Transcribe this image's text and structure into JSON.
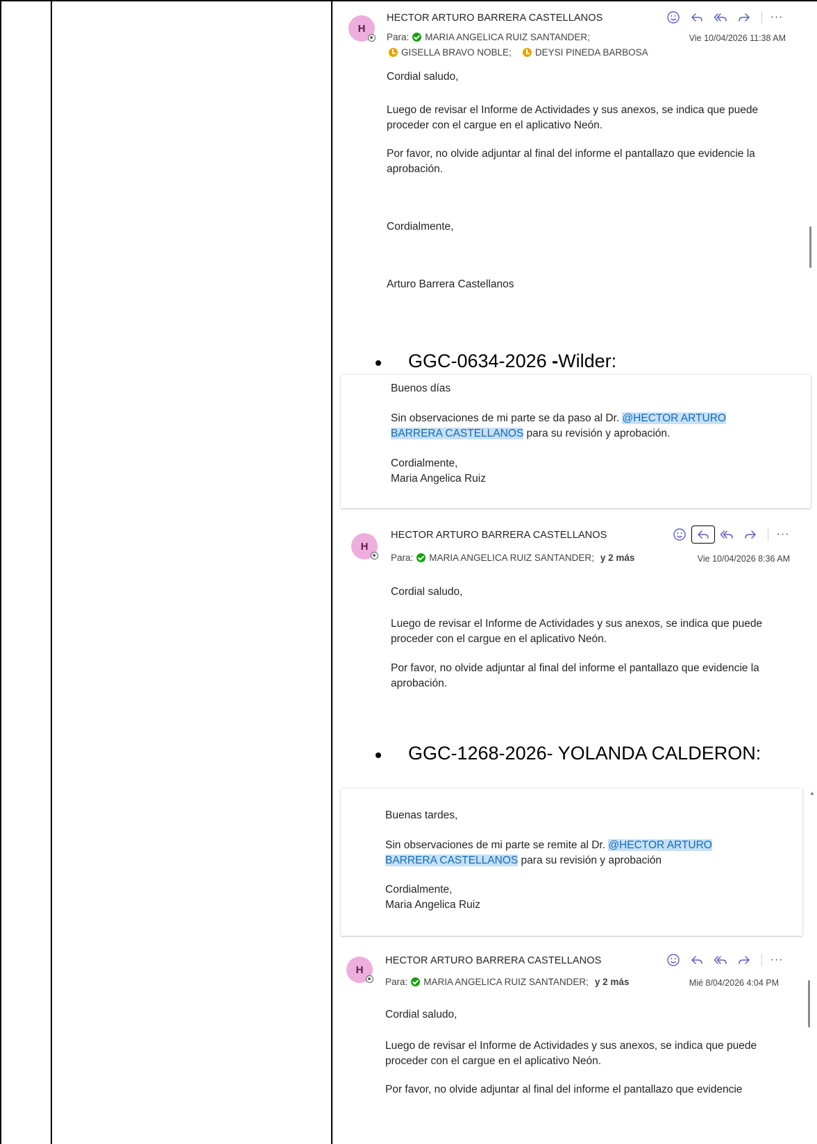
{
  "brand_colors": {
    "accent": "#5b5fc7",
    "mention_bg": "#c7e0f4",
    "mention_text": "#0f6cbd",
    "avatar_bg": "#eeaedd"
  },
  "icons": [
    "emoji-icon",
    "reply-icon",
    "reply-all-icon",
    "forward-icon",
    "more-icon"
  ],
  "email1": {
    "avatar": "H",
    "sender": "HECTOR ARTURO BARRERA CASTELLANOS",
    "to_label": "Para:",
    "recipient1": "MARIA ANGELICA RUIZ SANTANDER;",
    "recipient2": "GISELLA BRAVO NOBLE;",
    "recipient3": "DEYSI PINEDA BARBOSA",
    "date": "Vie 10/04/2026 11:38 AM",
    "greeting": "Cordial saludo,",
    "para1": "Luego de revisar el Informe de Actividades y sus anexos, se indica que puede proceder con el cargue en el aplicativo Neón.",
    "para2": "Por favor, no olvide adjuntar al final del informe el pantallazo que evidencie la aprobación.",
    "closing": "Cordialmente,",
    "signature": "Arturo Barrera Castellanos"
  },
  "bullet1": {
    "code": "GGC-0634-2026 ",
    "dash": "-",
    "name": "Wilder:"
  },
  "msg2": {
    "greeting": "Buenos días",
    "line_pre": "Sin observaciones de mi parte se da paso al Dr. ",
    "mention1": "@HECTOR ARTURO",
    "mention2": "BARRERA CASTELLANOS",
    "line_post": " para su revisión y aprobación.",
    "closing": "Cordialmente,",
    "signature": "Maria Angelica Ruiz"
  },
  "email3": {
    "avatar": "H",
    "sender": "HECTOR ARTURO BARRERA CASTELLANOS",
    "to_label": "Para:",
    "recipient1": "MARIA ANGELICA RUIZ SANTANDER;",
    "more": "y 2 más",
    "date": "Vie 10/04/2026 8:36 AM",
    "greeting": "Cordial saludo,",
    "para1": "Luego de revisar el Informe de Actividades y sus anexos, se indica que puede proceder con el cargue en el aplicativo Neón.",
    "para2": "Por favor, no olvide adjuntar al final del informe el pantallazo que evidencie la aprobación."
  },
  "bullet2": {
    "text": "GGC-1268-2026- YOLANDA CALDERON:"
  },
  "msg4": {
    "greeting": "Buenas tardes,",
    "line_pre": "Sin observaciones de mi parte se remite al Dr. ",
    "mention1": "@HECTOR ARTURO",
    "mention2": "BARRERA CASTELLANOS",
    "line_post": " para su revisión y aprobación",
    "closing": "Cordialmente,",
    "signature": "Maria Angelica Ruiz"
  },
  "email5": {
    "avatar": "H",
    "sender": "HECTOR ARTURO BARRERA CASTELLANOS",
    "to_label": "Para:",
    "recipient1": "MARIA ANGELICA RUIZ SANTANDER;",
    "more": "y 2 más",
    "date": "Mié 8/04/2026 4:04 PM",
    "greeting": "Cordial saludo,",
    "para1": "Luego de revisar el Informe de Actividades y sus anexos, se indica que puede proceder con el cargue en el aplicativo Neón.",
    "para2": "Por favor, no olvide adjuntar al final del informe el pantallazo que evidencie"
  }
}
